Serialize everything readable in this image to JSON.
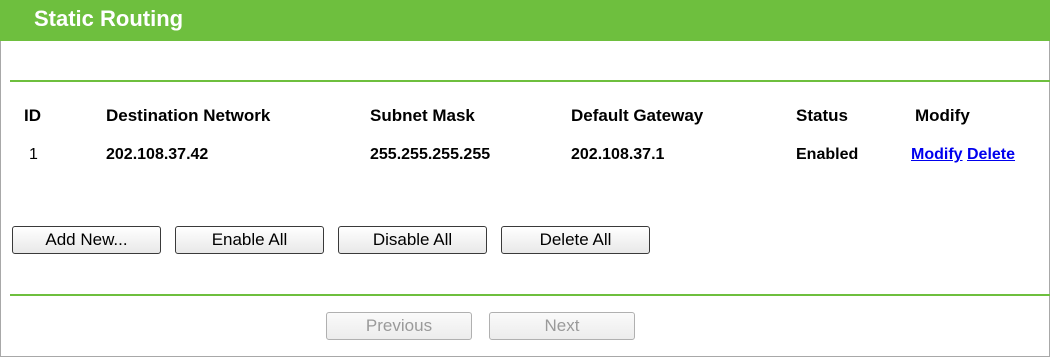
{
  "panel": {
    "title": "Static Routing"
  },
  "table": {
    "headers": {
      "id": "ID",
      "destination": "Destination Network",
      "subnet": "Subnet Mask",
      "gateway": "Default Gateway",
      "status": "Status",
      "modify": "Modify"
    },
    "rows": [
      {
        "id": "1",
        "destination": "202.108.37.42",
        "subnet": "255.255.255.255",
        "gateway": "202.108.37.1",
        "status": "Enabled",
        "modify_label": "Modify",
        "delete_label": "Delete"
      }
    ]
  },
  "actions": {
    "add_new": "Add New...",
    "enable_all": "Enable All",
    "disable_all": "Disable All",
    "delete_all": "Delete All"
  },
  "pagination": {
    "previous": "Previous",
    "next": "Next"
  },
  "colors": {
    "accent": "#6ebf3e",
    "link": "#0000ee"
  }
}
